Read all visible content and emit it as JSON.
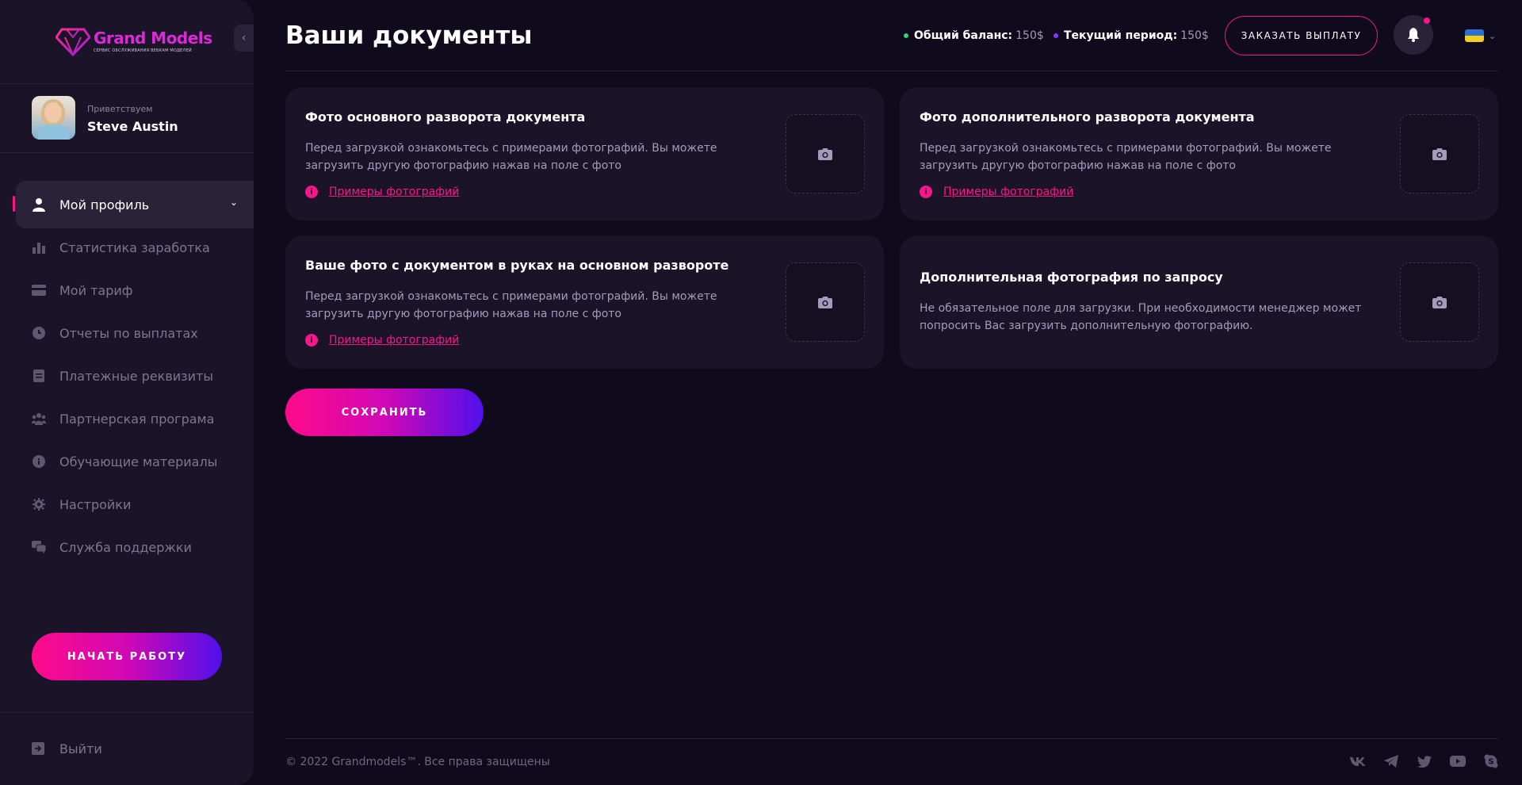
{
  "brand": {
    "name": "Grand Models",
    "tagline": "СЕРВИС ОБСЛУЖИВАНИЯ ВЕБКАМ МОДЕЛЕЙ"
  },
  "user": {
    "greeting": "Приветствуем",
    "name": "Steve Austin"
  },
  "sidebar": {
    "items": [
      {
        "label": "Мой профиль",
        "icon": "user-icon",
        "active": true
      },
      {
        "label": "Статистика заработка",
        "icon": "bar-chart-icon"
      },
      {
        "label": "Мой тариф",
        "icon": "credit-card-icon"
      },
      {
        "label": "Отчеты по выплатах",
        "icon": "clock-icon"
      },
      {
        "label": "Платежные реквизиты",
        "icon": "document-icon"
      },
      {
        "label": "Партнерская програма",
        "icon": "users-icon"
      },
      {
        "label": "Обучающие материалы",
        "icon": "info-icon"
      },
      {
        "label": "Настройки",
        "icon": "gear-icon"
      },
      {
        "label": "Служба поддержки",
        "icon": "chat-icon"
      }
    ],
    "start_label": "НАЧАТЬ РАБОТУ",
    "logout_label": "Выйти"
  },
  "header": {
    "title": "Ваши документы",
    "total_balance_label": "Общий баланс:",
    "total_balance_value": "150$",
    "current_period_label": "Текущий период:",
    "current_period_value": "150$",
    "payout_label": "ЗАКАЗАТЬ ВЫПЛАТУ",
    "colors": {
      "accent": "#f8168a",
      "green_dot": "#2ed573",
      "purple_dot": "#7b3cff"
    }
  },
  "documents": [
    {
      "title": "Фото основного разворота документа",
      "desc": "Перед загрузкой ознакомьтесь с примерами фотографий. Вы можете загрузить другую фотографию нажав на поле с фото",
      "link": "Примеры фотографий"
    },
    {
      "title": "Фото дополнительного разворота документа",
      "desc": "Перед загрузкой ознакомьтесь с примерами фотографий. Вы можете загрузить другую фотографию нажав на поле с фото",
      "link": "Примеры фотографий"
    },
    {
      "title": "Ваше фото с документом в руках на основном развороте",
      "desc": "Перед загрузкой ознакомьтесь с примерами фотографий. Вы можете загрузить другую фотографию нажав на поле с фото",
      "link": "Примеры фотографий"
    },
    {
      "title": "Дополнительная фотография по запросу",
      "desc": "Не обязательное поле для загрузки. При необходимости менеджер может попросить Вас загрузить дополнительную фотографию."
    }
  ],
  "save_label": "СОХРАНИТЬ",
  "footer": {
    "copyright": "© 2022 Grandmodels™. Все права защищены",
    "socials": [
      "vk-icon",
      "telegram-icon",
      "twitter-icon",
      "youtube-icon",
      "skype-icon"
    ]
  }
}
